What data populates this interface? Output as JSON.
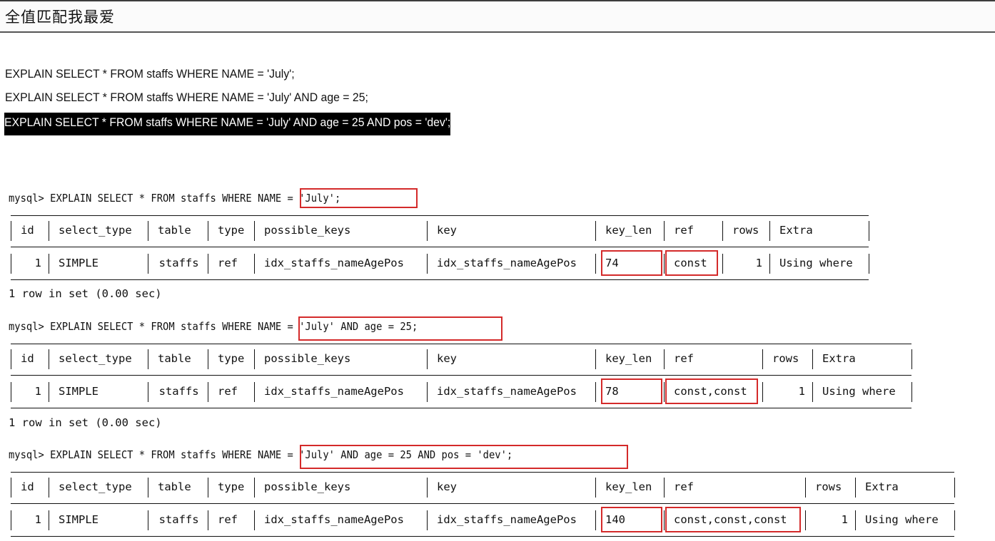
{
  "header": {
    "title": "全值匹配我最爱"
  },
  "queries": [
    "EXPLAIN SELECT * FROM staffs WHERE NAME = 'July';",
    "EXPLAIN SELECT * FROM staffs WHERE NAME = 'July' AND age = 25;",
    "EXPLAIN SELECT * FROM staffs WHERE NAME = 'July' AND age = 25 AND pos = 'dev';"
  ],
  "terminal": {
    "prompts": [
      {
        "prefix": "mysql> EXPLAIN SELECT * FROM staffs WHERE ",
        "condition": "NAME = 'July';"
      },
      {
        "prefix": "mysql> EXPLAIN SELECT * FROM staffs WHERE ",
        "condition": "NAME = 'July' AND age = 25;"
      },
      {
        "prefix": "mysql> EXPLAIN SELECT * FROM staffs WHERE ",
        "condition": "NAME = 'July' AND age = 25 AND pos = 'dev';"
      }
    ],
    "columns": [
      "id",
      "select_type",
      "table",
      "type",
      "possible_keys",
      "key",
      "key_len",
      "ref",
      "rows",
      "Extra"
    ],
    "results": [
      [
        "1",
        "SIMPLE",
        "staffs",
        "ref",
        "idx_staffs_nameAgePos",
        "idx_staffs_nameAgePos",
        "74",
        "const",
        "1",
        "Using where"
      ],
      [
        "1",
        "SIMPLE",
        "staffs",
        "ref",
        "idx_staffs_nameAgePos",
        "idx_staffs_nameAgePos",
        "78",
        "const,const",
        "1",
        "Using where"
      ],
      [
        "1",
        "SIMPLE",
        "staffs",
        "ref",
        "idx_staffs_nameAgePos",
        "idx_staffs_nameAgePos",
        "140",
        "const,const,const",
        "1",
        "Using where"
      ]
    ],
    "row_summary": "1 row in set (0.00 sec)",
    "highlight_color": "#d42a2a"
  }
}
